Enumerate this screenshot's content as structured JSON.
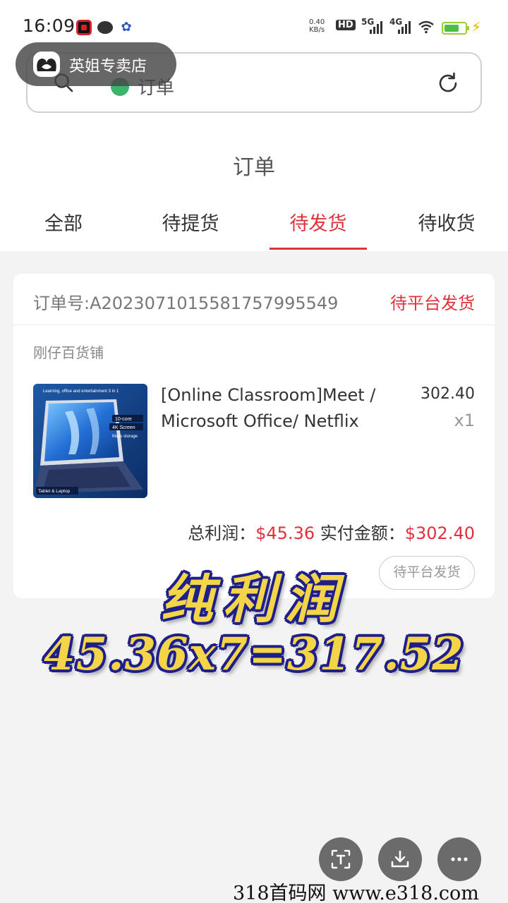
{
  "status_bar": {
    "time": "16:09",
    "net_speed_value": "0.40",
    "net_speed_unit": "KB/s",
    "badges": [
      "HD",
      "5G",
      "4G"
    ],
    "icons": [
      "screen-record-icon",
      "chat-icon",
      "app-icon",
      "wifi-icon",
      "battery-icon",
      "charging-icon"
    ]
  },
  "store_overlay": {
    "name": "英姐专卖店"
  },
  "search": {
    "value": "订单"
  },
  "page": {
    "title": "订单"
  },
  "tabs": [
    {
      "label": "全部",
      "active": false
    },
    {
      "label": "待提货",
      "active": false
    },
    {
      "label": "待发货",
      "active": true
    },
    {
      "label": "待收货",
      "active": false
    }
  ],
  "order": {
    "number": "订单号:A2023071015581757995549",
    "status": "待平台发货",
    "shop": "刚仔百货铺",
    "product": {
      "title": "[Online Classroom]Meet / Microsoft Office/ Netflix",
      "price": "302.40",
      "qty": "x1",
      "image_lines": [
        "Learning, office and entertainment 3 in 1",
        "10-core",
        "4K Screen",
        "Mass storage",
        "Tablet & Laptop"
      ]
    },
    "summary": {
      "profit_label": "总利润：",
      "profit_value": "$45.36",
      "paid_label": "实付金额：",
      "paid_value": "$302.40"
    },
    "action_button": "待平台发货"
  },
  "overlay": {
    "title": "纯利润",
    "calc": "45.36x7=317.52"
  },
  "watermark": "318首码网  www.e318.com",
  "colors": {
    "accent": "#e0323c",
    "overlay_fill": "#f4d548",
    "overlay_stroke": "#1e1f8a"
  }
}
